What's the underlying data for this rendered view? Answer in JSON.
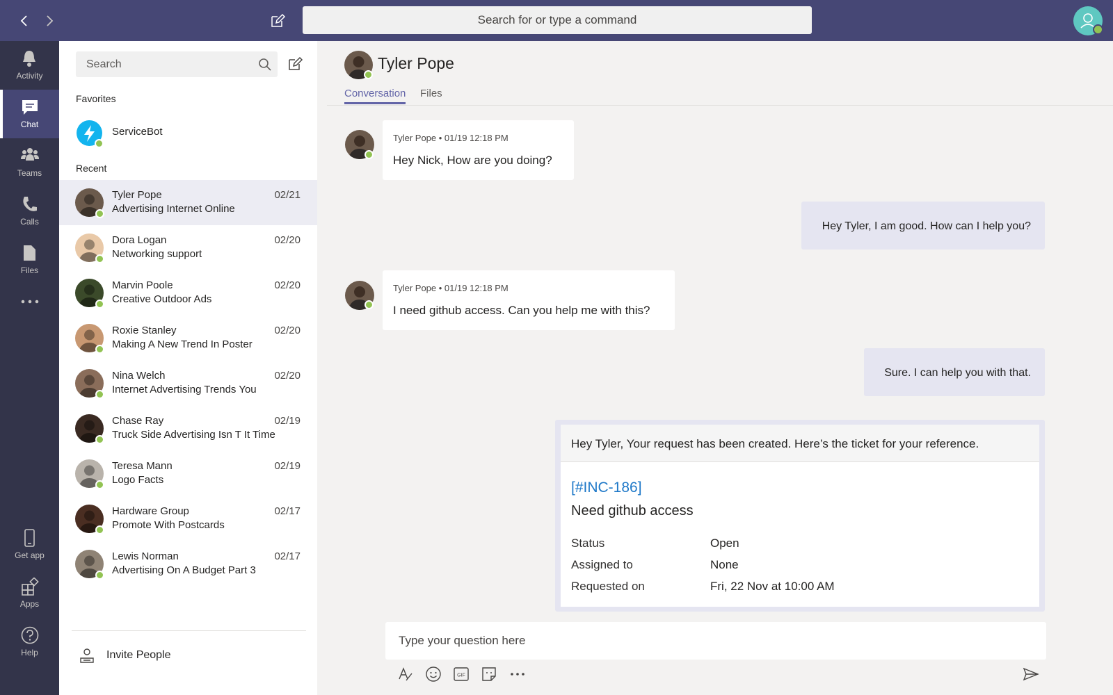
{
  "top": {
    "search_placeholder": "Search for or type a command"
  },
  "rail": {
    "items": [
      {
        "label": "Activity",
        "icon": "bell-icon"
      },
      {
        "label": "Chat",
        "icon": "chat-icon"
      },
      {
        "label": "Teams",
        "icon": "teams-icon"
      },
      {
        "label": "Calls",
        "icon": "phone-icon"
      },
      {
        "label": "Files",
        "icon": "file-icon"
      },
      {
        "label": "",
        "icon": "more-icon"
      },
      {
        "label": "Get app",
        "icon": "mobile-icon"
      },
      {
        "label": "Apps",
        "icon": "apps-icon"
      },
      {
        "label": "Help",
        "icon": "help-icon"
      }
    ]
  },
  "chatlist": {
    "search_placeholder": "Search",
    "favorites_heading": "Favorites",
    "recent_heading": "Recent",
    "favorites": [
      {
        "name": "ServiceBot"
      }
    ],
    "recent": [
      {
        "name": "Tyler Pope",
        "preview": "Advertising Internet Online",
        "date": "02/21",
        "color": "#6b5a4c"
      },
      {
        "name": "Dora Logan",
        "preview": "Networking support",
        "date": "02/20",
        "color": "#e9c9a8"
      },
      {
        "name": "Marvin Poole",
        "preview": "Creative Outdoor Ads",
        "date": "02/20",
        "color": "#3b4a2a"
      },
      {
        "name": "Roxie Stanley",
        "preview": "Making A New Trend In Poster",
        "date": "02/20",
        "color": "#c89872"
      },
      {
        "name": "Nina Welch",
        "preview": "Internet Advertising Trends You",
        "date": "02/20",
        "color": "#8a6d5a"
      },
      {
        "name": "Chase Ray",
        "preview": "Truck Side Advertising Isn T It Time",
        "date": "02/19",
        "color": "#3a2a22"
      },
      {
        "name": "Teresa Mann",
        "preview": "Logo Facts",
        "date": "02/19",
        "color": "#b9b3ab"
      },
      {
        "name": "Hardware Group",
        "preview": "Promote With Postcards",
        "date": "02/17",
        "color": "#4a2e22"
      },
      {
        "name": "Lewis Norman",
        "preview": "Advertising On A Budget Part 3",
        "date": "02/17",
        "color": "#8f8375"
      }
    ],
    "invite_label": "Invite People"
  },
  "conversation": {
    "contact_name": "Tyler Pope",
    "tabs": [
      "Conversation",
      "Files"
    ],
    "messages": [
      {
        "meta": "Tyler Pope • 01/19 12:18 PM",
        "text": "Hey Nick, How are you doing?"
      },
      {
        "text": "Hey Tyler, I am good. How can I help you?"
      },
      {
        "meta": "Tyler Pope • 01/19 12:18 PM",
        "text": "I need github access. Can you help me with this?"
      },
      {
        "text": "Sure. I can help you with that."
      }
    ],
    "card": {
      "header": "Hey Tyler, Your request has been created. Here’s the ticket for your reference.",
      "ticket_id": "[#INC-186]",
      "ticket_title": "Need github access",
      "fields": [
        {
          "label": "Status",
          "value": "Open"
        },
        {
          "label": "Assigned to",
          "value": "None"
        },
        {
          "label": "Requested on",
          "value": "Fri, 22 Nov at 10:00 AM"
        }
      ]
    },
    "compose_placeholder": "Type your question here"
  },
  "colors": {
    "topbar": "#464775",
    "rail": "#33344a",
    "accent": "#6264a7",
    "presence": "#92c353",
    "link": "#1e78c8"
  }
}
